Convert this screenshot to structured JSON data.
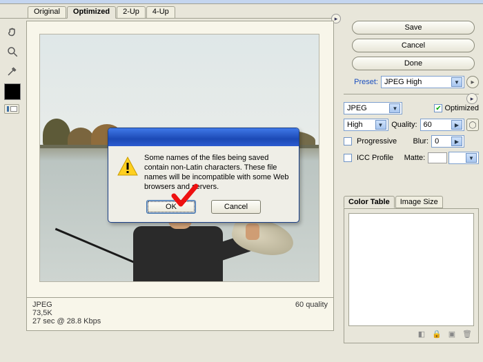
{
  "tabs": [
    "Original",
    "Optimized",
    "2-Up",
    "4-Up"
  ],
  "active_tab": "Optimized",
  "buttons": {
    "save": "Save",
    "cancel": "Cancel",
    "done": "Done"
  },
  "preset": {
    "label": "Preset:",
    "value": "JPEG High"
  },
  "format": {
    "value": "JPEG"
  },
  "quality_preset": {
    "value": "High"
  },
  "optimized": {
    "label": "Optimized",
    "checked": true
  },
  "quality": {
    "label": "Quality:",
    "value": "60"
  },
  "progressive": {
    "label": "Progressive",
    "checked": false
  },
  "blur": {
    "label": "Blur:",
    "value": "0"
  },
  "icc": {
    "label": "ICC Profile",
    "checked": false
  },
  "matte": {
    "label": "Matte:"
  },
  "status": {
    "format": "JPEG",
    "size": "73,5K",
    "time": "27 sec @ 28.8 Kbps",
    "quality": "60 quality"
  },
  "panel_tabs": [
    "Color Table",
    "Image Size"
  ],
  "dialog": {
    "message": "Some names of the files being saved contain non-Latin characters.  These file names will be incompatible with some Web browsers and servers.",
    "ok": "OK",
    "cancel": "Cancel"
  }
}
